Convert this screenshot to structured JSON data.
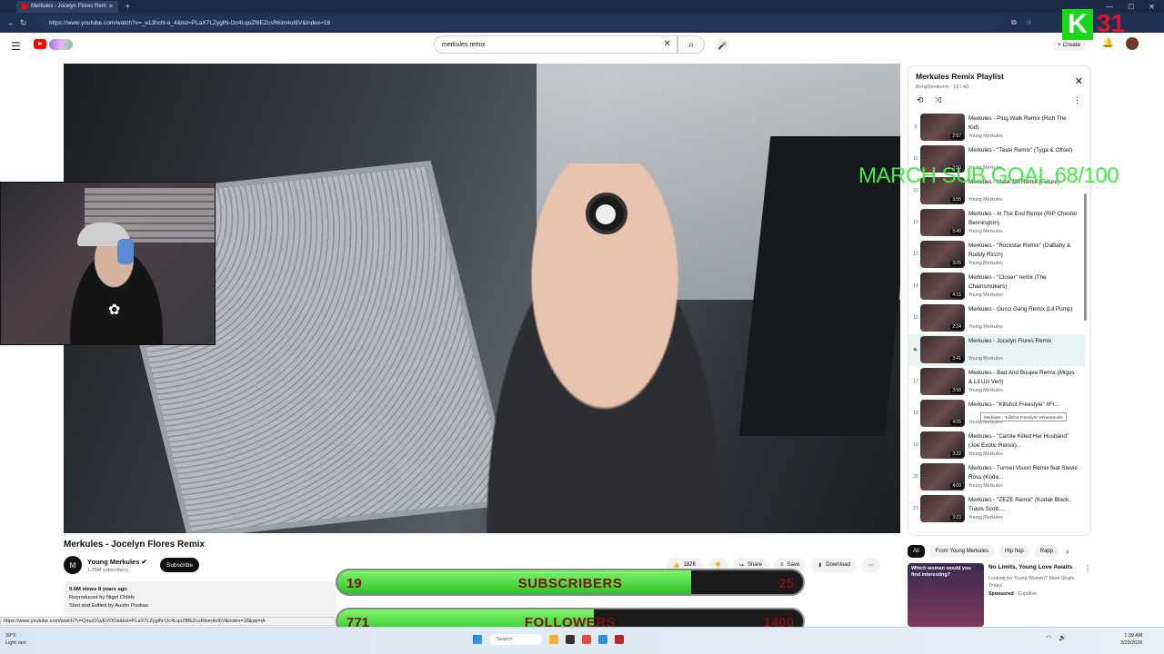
{
  "browser": {
    "tab_title": "Merkules - Jocelyn Flores Rem",
    "url": "https://www.youtube.com/watch?v=_e13hcN-e_4&list=PLaX7LZygIN-Oc4LqoZf8EZcsRkim4oI6V&index=16",
    "status_url": "https://www.youtube.com/watch?v=QmuOSyEVOOs&list=PLaX7LZygIN-Oc4LqoZf8EZcsRkim4oI6V&index=18&pp=iA"
  },
  "youtube": {
    "search_value": "merkules remix",
    "create_label": "Create"
  },
  "video": {
    "title": "Merkules - Jocelyn Flores Remix",
    "channel": "Young Merkules",
    "channel_initial": "M",
    "subscribers": "1.75M subscribers",
    "subscribe_label": "Subscribe",
    "likes": "182K",
    "share_label": "Share",
    "save_label": "Save",
    "download_label": "Download",
    "views_line": "9.6M views  8 years ago",
    "desc_line1": "Reproduced by Nigel Childs",
    "desc_line2": "Shot and Edited by Austin Puskas"
  },
  "playlist": {
    "title": "Merkules Remix Playlist",
    "owner": "BongSmokerm · 16 / 43",
    "items": [
      {
        "idx": "9",
        "name": "Merkules - Plug Walk Remix (Rich The Kid)",
        "artist": "Young Merkules",
        "duration": "2:57"
      },
      {
        "idx": "10",
        "name": "Merkules - \"Taste Remix\" (Tyga & Offset)",
        "artist": "Young Merkules",
        "duration": "3:50"
      },
      {
        "idx": "11",
        "name": "Merkules - Mask Off Remix (Future)",
        "artist": "Young Merkules",
        "duration": "3:55"
      },
      {
        "idx": "12",
        "name": "Merkules - In The End Remix (RIP Chester Bennington)",
        "artist": "Young Merkules",
        "duration": "3:40"
      },
      {
        "idx": "13",
        "name": "Merkules - \"Rockstar Remix\" (DaBaby & Roddy Ricch)",
        "artist": "Young Merkules",
        "duration": "3:05"
      },
      {
        "idx": "14",
        "name": "Merkules - \"Closer\" remix (The Chainsmokers)",
        "artist": "Young Merkules",
        "duration": "4:15"
      },
      {
        "idx": "15",
        "name": "Merkules - Gucci Gang Remix (Lil Pump)",
        "artist": "Young Merkules",
        "duration": "2:24"
      },
      {
        "idx": "▶",
        "name": "Merkules - Jocelyn Flores Remix",
        "artist": "Young Merkules",
        "duration": "3:41"
      },
      {
        "idx": "17",
        "name": "Merkules - Bad And Boujee Remix (Migos & Lil Uzi Vert)",
        "artist": "Young Merkules",
        "duration": "3:50"
      },
      {
        "idx": "18",
        "name": "Merkules - \"Killshot Freestyle\" #Fr...",
        "artist": "Young Merkules",
        "duration": "4:05"
      },
      {
        "idx": "19",
        "name": "Merkules - \"Carole Killed Her Husband\" (Joe Exotic Remix)...",
        "artist": "Young Merkules",
        "duration": "3:22"
      },
      {
        "idx": "20",
        "name": "Merkules - Tunnel Vision Remix feat Stevie Ross (Koda...",
        "artist": "Young Merkules",
        "duration": "4:00"
      },
      {
        "idx": "21",
        "name": "Merkules - \"ZEZE Remix\" (Kodak Black, Travis Scott,...",
        "artist": "Young Merkules",
        "duration": "3:23"
      }
    ],
    "tooltip": "Merkules - \"Killshot Freestyle\" #FreeSmoke"
  },
  "chips": [
    "All",
    "From Young Merkules",
    "Hip hop",
    "Rapp"
  ],
  "ad": {
    "thumb_text": "Which woman would you find interesting?",
    "title": "No Limits, Young Love Awaits",
    "desc": "Looking for Young Women? Meet Single Today!",
    "sponsored": "Sponsored",
    "advertiser": "Cupidive"
  },
  "overlay": {
    "goal_text": "MARCH SUB GOAL 68/100",
    "badge_letter": "K",
    "badge_number": "31",
    "subs_current": "19",
    "subs_label": "SUBSCRIBERS",
    "subs_goal": "25",
    "subs_progress": 0.76,
    "follow_current": "771",
    "follow_label": "FOLLOWERS",
    "follow_goal": "1400",
    "follow_progress": 0.55
  },
  "taskbar": {
    "temp": "39°F",
    "weather": "Light rain",
    "search": "Search",
    "time": "1:39 AM",
    "date": "3/23/2026"
  }
}
